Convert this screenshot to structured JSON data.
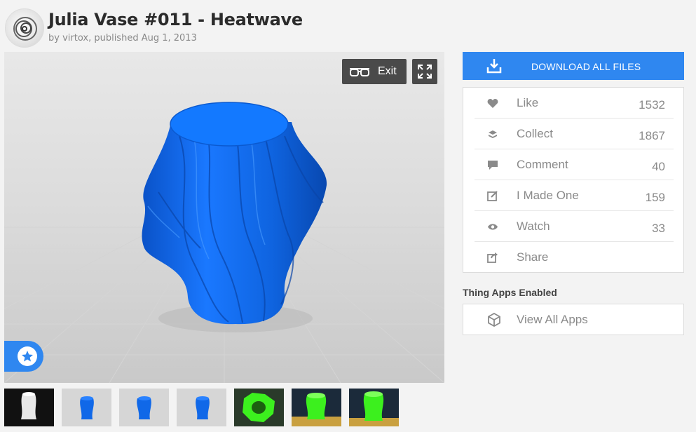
{
  "header": {
    "title": "Julia Vase #011 - Heatwave",
    "byline": "by virtox, published Aug 1, 2013"
  },
  "viewer": {
    "exit_label": "Exit",
    "model_color": "#0f6cf0"
  },
  "thumbnails": [
    {
      "name": "thumb-white-vase-dark"
    },
    {
      "name": "thumb-blue-vase-1"
    },
    {
      "name": "thumb-blue-vase-2"
    },
    {
      "name": "thumb-blue-vase-3"
    },
    {
      "name": "thumb-green-print-top"
    },
    {
      "name": "thumb-green-print-2"
    },
    {
      "name": "thumb-green-print-3"
    }
  ],
  "sidebar": {
    "download_label": "DOWNLOAD ALL FILES",
    "actions": [
      {
        "label": "Like",
        "count": "1532",
        "icon": "heart-icon"
      },
      {
        "label": "Collect",
        "count": "1867",
        "icon": "collection-icon"
      },
      {
        "label": "Comment",
        "count": "40",
        "icon": "comment-icon"
      },
      {
        "label": "I Made One",
        "count": "159",
        "icon": "pencil-square-icon"
      },
      {
        "label": "Watch",
        "count": "33",
        "icon": "eye-icon"
      },
      {
        "label": "Share",
        "count": "",
        "icon": "share-icon"
      }
    ],
    "apps_heading": "Thing Apps Enabled",
    "apps_link": "View All Apps"
  },
  "colors": {
    "accent": "#2f87f0",
    "text_muted": "#8a8a8a",
    "green_print": "#3cf01e"
  }
}
